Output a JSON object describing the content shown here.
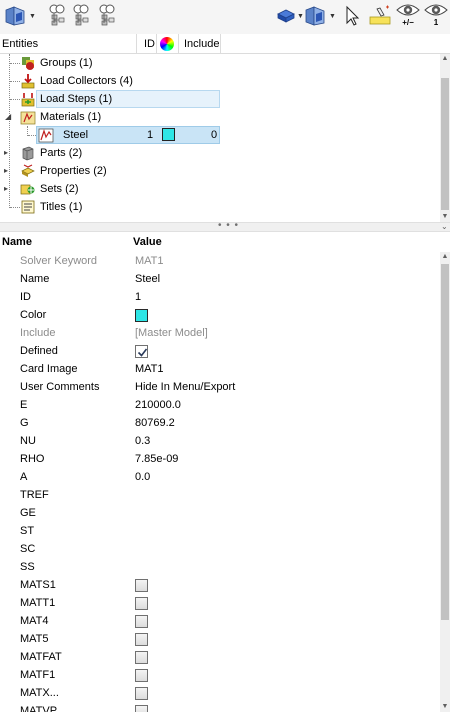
{
  "toolbar": {
    "buttons": [
      {
        "name": "entity-display-button",
        "icon": "folder-cube-icon"
      },
      {
        "name": "filter-button-1",
        "icon": "tree-filter-icon"
      },
      {
        "name": "filter-button-2",
        "icon": "tree-filter-icon"
      },
      {
        "name": "filter-button-3",
        "icon": "tree-filter-icon"
      },
      {
        "name": "blue-cube-button",
        "icon": "cube-icon"
      },
      {
        "name": "entity-select-button",
        "icon": "folder-cube-icon"
      },
      {
        "name": "pointer-button",
        "icon": "cursor-icon"
      },
      {
        "name": "highlight-button",
        "icon": "highlighter-icon"
      }
    ],
    "eye_toggle_label": "+/−",
    "eye_one_label": "1"
  },
  "tree_header": {
    "entities": "Entities",
    "id": "ID",
    "include": "Include"
  },
  "tree": {
    "items": [
      {
        "label": "Groups (1)",
        "icon": "groups-icon"
      },
      {
        "label": "Load Collectors (4)",
        "icon": "load-collector-icon"
      },
      {
        "label": "Load Steps (1)",
        "icon": "load-step-icon"
      },
      {
        "label": "Materials (1)",
        "icon": "materials-icon"
      },
      {
        "label": "Steel",
        "icon": "material-icon",
        "id": "1",
        "include": "0",
        "color": "#2ee6e6"
      },
      {
        "label": "Parts (2)",
        "icon": "parts-icon"
      },
      {
        "label": "Properties (2)",
        "icon": "properties-icon"
      },
      {
        "label": "Sets (2)",
        "icon": "sets-icon"
      },
      {
        "label": "Titles (1)",
        "icon": "titles-icon"
      }
    ]
  },
  "props_header": {
    "name": "Name",
    "value": "Value"
  },
  "properties": [
    {
      "name": "Solver Keyword",
      "value": "MAT1",
      "muted": true
    },
    {
      "name": "Name",
      "value": "Steel"
    },
    {
      "name": "ID",
      "value": "1"
    },
    {
      "name": "Color",
      "value": "",
      "swatch": "#2ee6e6"
    },
    {
      "name": "Include",
      "value": "[Master Model]",
      "muted": true
    },
    {
      "name": "Defined",
      "value": "",
      "checkbox": true,
      "checked": true
    },
    {
      "name": "Card Image",
      "value": "MAT1"
    },
    {
      "name": "User Comments",
      "value": "Hide In Menu/Export"
    },
    {
      "name": "E",
      "value": "210000.0"
    },
    {
      "name": "G",
      "value": "80769.2"
    },
    {
      "name": "NU",
      "value": "0.3"
    },
    {
      "name": "RHO",
      "value": "7.85e-09"
    },
    {
      "name": "A",
      "value": "0.0"
    },
    {
      "name": "TREF",
      "value": ""
    },
    {
      "name": "GE",
      "value": ""
    },
    {
      "name": "ST",
      "value": ""
    },
    {
      "name": "SC",
      "value": ""
    },
    {
      "name": "SS",
      "value": ""
    },
    {
      "name": "MATS1",
      "value": "",
      "checkbox": true,
      "checked": false
    },
    {
      "name": "MATT1",
      "value": "",
      "checkbox": true,
      "checked": false
    },
    {
      "name": "MAT4",
      "value": "",
      "checkbox": true,
      "checked": false
    },
    {
      "name": "MAT5",
      "value": "",
      "checkbox": true,
      "checked": false
    },
    {
      "name": "MATFAT",
      "value": "",
      "checkbox": true,
      "checked": false
    },
    {
      "name": "MATF1",
      "value": "",
      "checkbox": true,
      "checked": false
    },
    {
      "name": "MATX...",
      "value": "",
      "checkbox": true,
      "checked": false
    },
    {
      "name": "MATVP",
      "value": "",
      "checkbox": true,
      "checked": false
    }
  ],
  "colors": {
    "selection": "#c9e4f6",
    "selection_border": "#9fcbe8",
    "material_color": "#2ee6e6"
  }
}
